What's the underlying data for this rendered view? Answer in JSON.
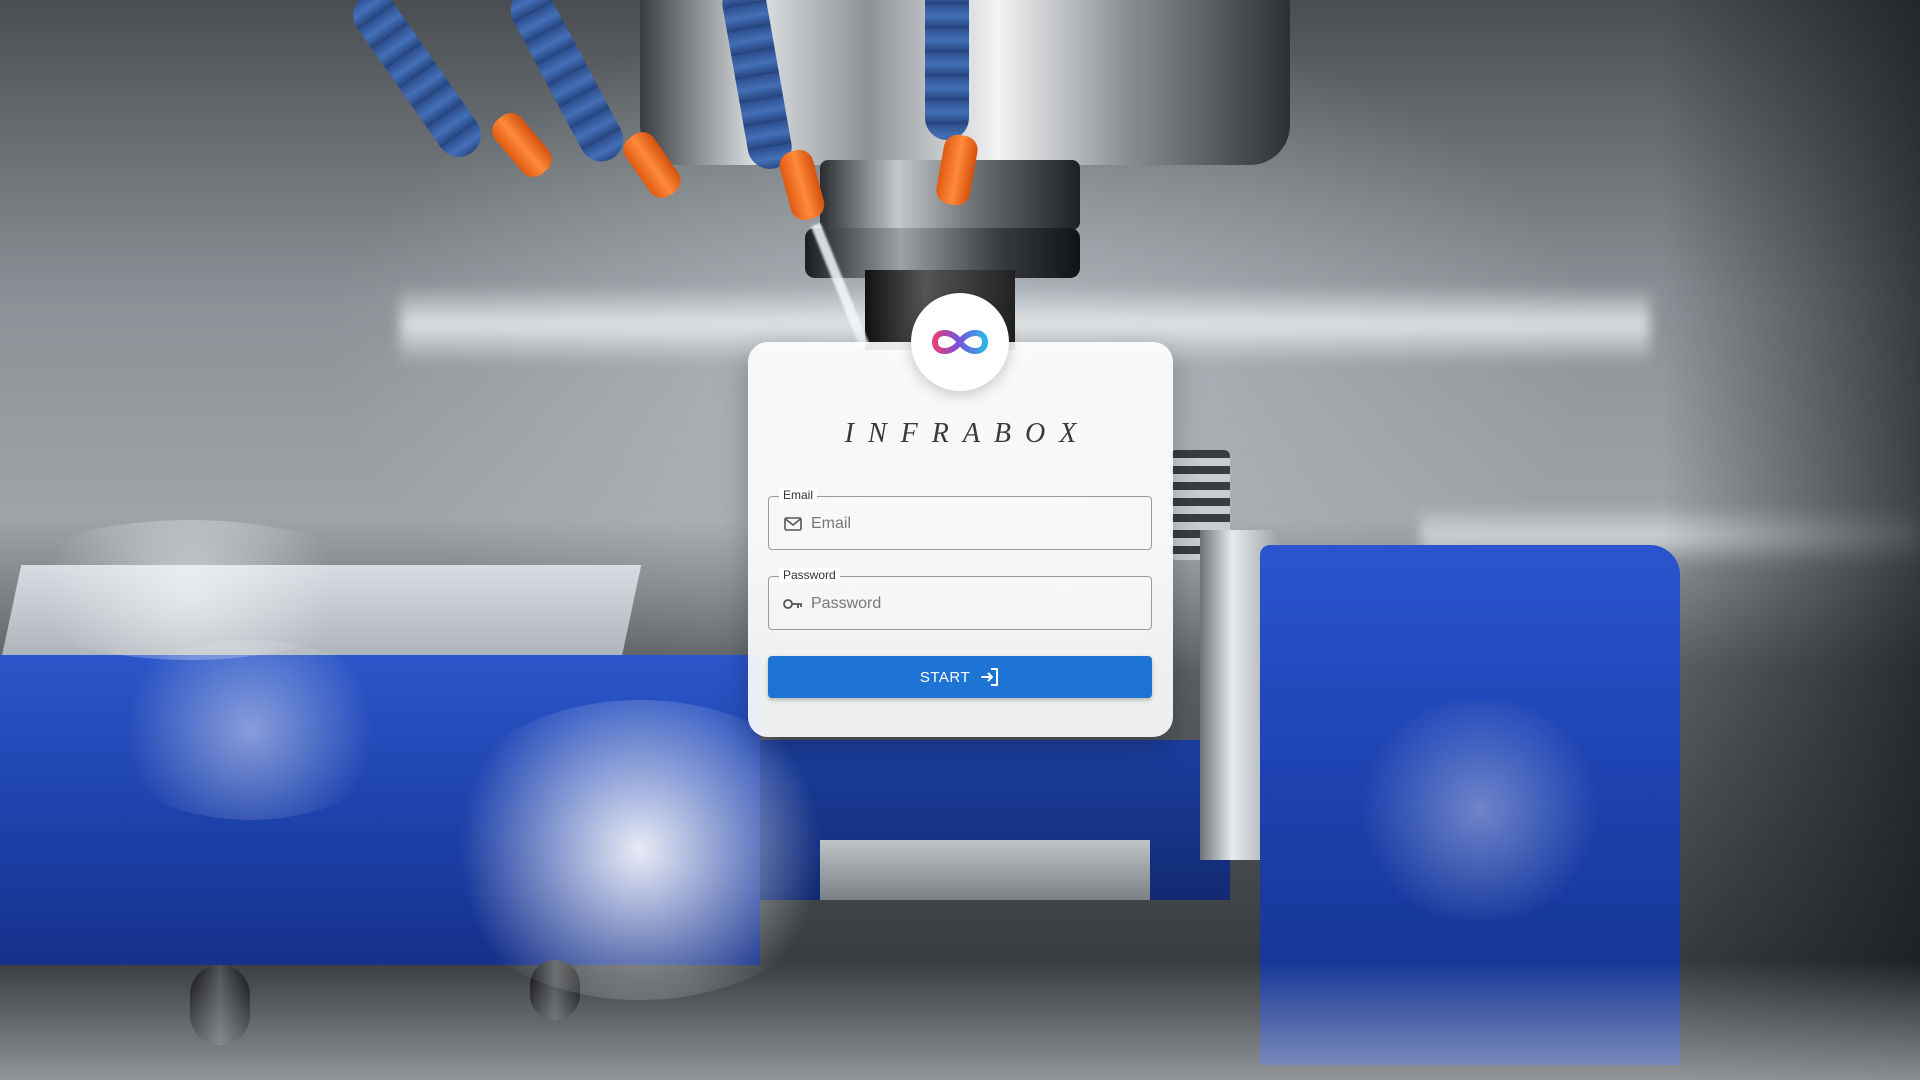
{
  "brand": {
    "name": "INFRABOX",
    "logo_icon": "infinity-icon"
  },
  "form": {
    "email": {
      "label": "Email",
      "placeholder": "Email",
      "value": "",
      "icon": "mail-icon"
    },
    "password": {
      "label": "Password",
      "placeholder": "Password",
      "value": "",
      "icon": "key-icon"
    },
    "submit": {
      "label": "START",
      "icon": "login-icon"
    }
  },
  "colors": {
    "accent": "#1e74d4",
    "logo_gradient": [
      "#e6407a",
      "#7b4fd6",
      "#2bb3e8"
    ]
  }
}
